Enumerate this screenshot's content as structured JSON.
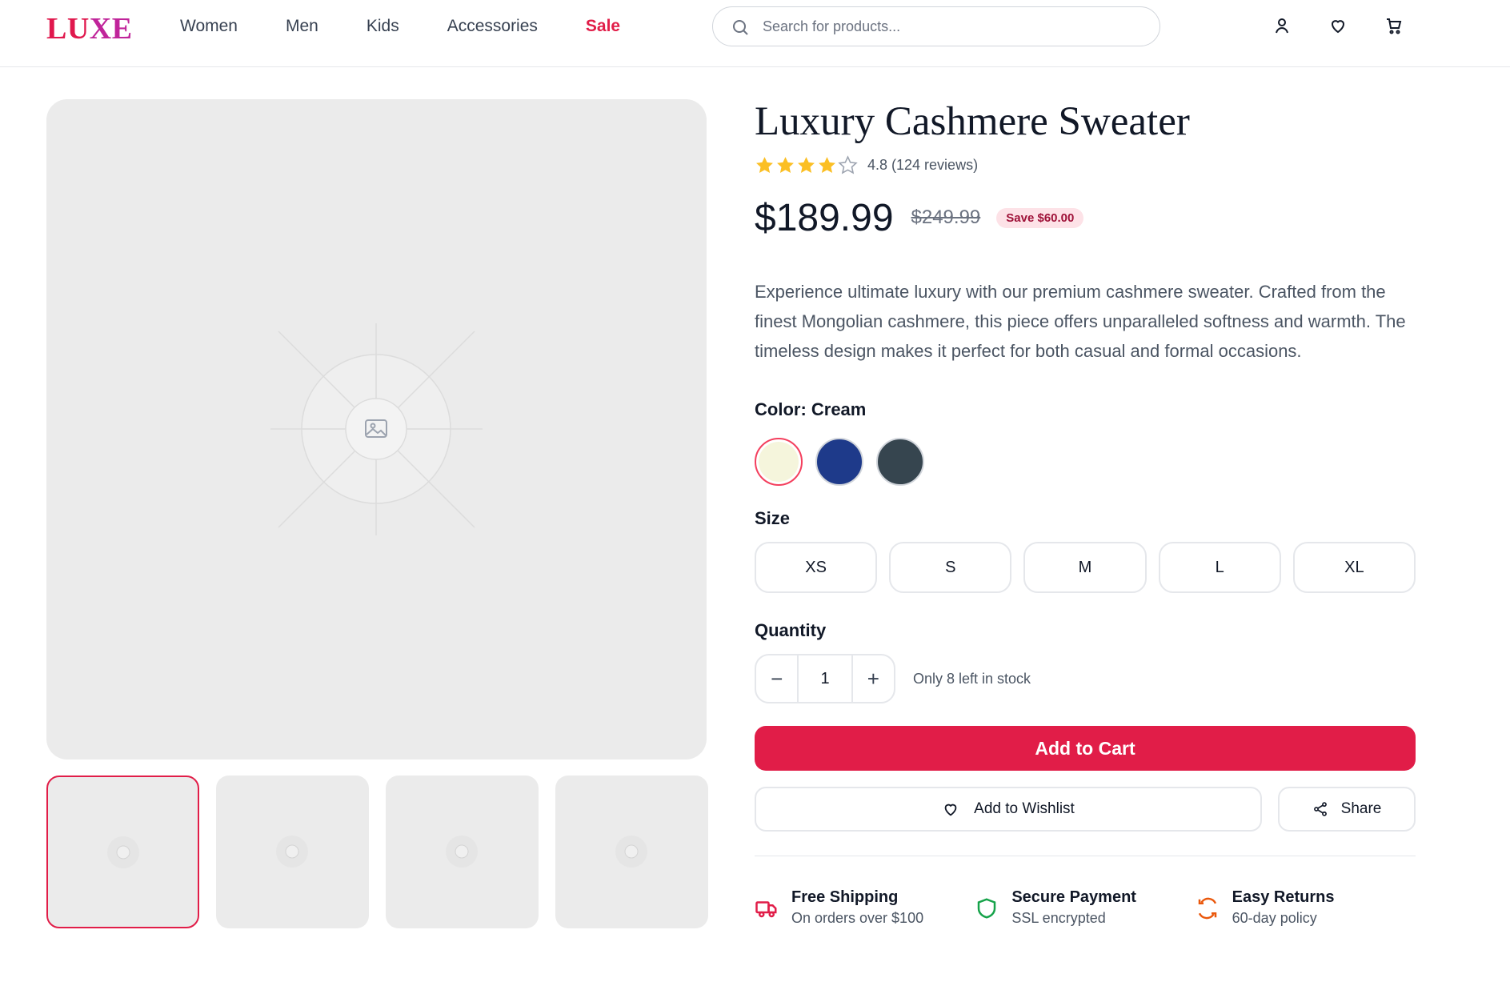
{
  "header": {
    "logo": "LUXE",
    "nav": [
      "Women",
      "Men",
      "Kids",
      "Accessories",
      "Sale"
    ],
    "search_placeholder": "Search for products..."
  },
  "product": {
    "title": "Luxury Cashmere Sweater",
    "rating": 4.8,
    "rating_text": "4.8 (124 reviews)",
    "stars_filled": 4,
    "stars_total": 5,
    "price": "$189.99",
    "old_price": "$249.99",
    "save_text": "Save $60.00",
    "description": "Experience ultimate luxury with our premium cashmere sweater. Crafted from the finest Mongolian cashmere, this piece offers unparalleled softness and warmth. The timeless design makes it perfect for both casual and formal occasions.",
    "color_label": "Color: Cream",
    "colors": [
      {
        "name": "Cream",
        "hex": "#f5f5dc",
        "selected": true
      },
      {
        "name": "Navy",
        "hex": "#1e3a8a",
        "selected": false
      },
      {
        "name": "Charcoal",
        "hex": "#36454f",
        "selected": false
      }
    ],
    "size_label": "Size",
    "sizes": [
      "XS",
      "S",
      "M",
      "L",
      "XL"
    ],
    "quantity_label": "Quantity",
    "quantity": "1",
    "stock_text": "Only 8 left in stock",
    "add_to_cart": "Add to Cart",
    "wishlist": "Add to Wishlist",
    "share": "Share"
  },
  "features": [
    {
      "title": "Free Shipping",
      "sub": "On orders over $100",
      "icon": "truck-icon",
      "color": "#e11d48"
    },
    {
      "title": "Secure Payment",
      "sub": "SSL encrypted",
      "icon": "shield-icon",
      "color": "#16a34a"
    },
    {
      "title": "Easy Returns",
      "sub": "60-day policy",
      "icon": "refresh-icon",
      "color": "#ea580c"
    }
  ],
  "colors": {
    "accent": "#e11d48",
    "star": "#fbbf24"
  }
}
